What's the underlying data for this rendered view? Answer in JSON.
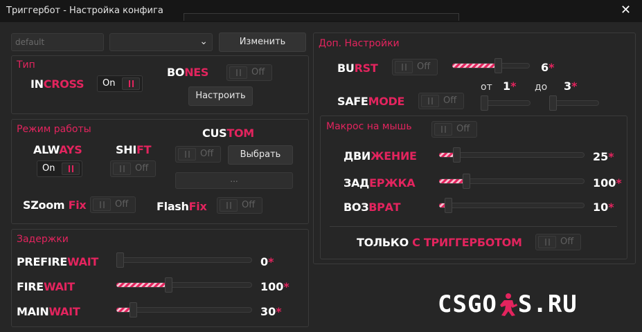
{
  "window": {
    "title": "Триггербот - Настройка конфига",
    "close_glyph": "✕"
  },
  "top": {
    "config_value": "default",
    "dropdown_value": "",
    "change_label": "Изменить"
  },
  "type_panel": {
    "title": "Тип",
    "incross": {
      "w": "IN",
      "p": "CROSS",
      "toggle_text": "On",
      "state": "on"
    },
    "bones": {
      "w": "BO",
      "p": "NES",
      "toggle_text": "Off",
      "state": "off"
    },
    "configure_label": "Настроить"
  },
  "mode_panel": {
    "title": "Режим работы",
    "always": {
      "w": "ALW",
      "p": "AYS",
      "toggle_text": "On",
      "state": "on"
    },
    "shift": {
      "w": "SHI",
      "p": "FT",
      "toggle_text": "Off",
      "state": "off"
    },
    "custom": {
      "w": "CUS",
      "p": "TOM",
      "toggle_text": "Off",
      "state": "off"
    },
    "select_label": "Выбрать",
    "key_value": "...",
    "szoom": {
      "w": "SZoom ",
      "p": "Fix",
      "toggle_text": "Off",
      "state": "off"
    },
    "flash": {
      "w": "Flash",
      "p": "Fix",
      "toggle_text": "Off",
      "state": "off"
    }
  },
  "delays_panel": {
    "title": "Задержки",
    "prefire": {
      "w": "PREFIRE",
      "p": "WAIT",
      "value": "0",
      "star": "*",
      "fraction": 0.0
    },
    "fire": {
      "w": "FIRE",
      "p": "WAIT",
      "value": "100",
      "star": "*",
      "fraction": 0.38
    },
    "main": {
      "w": "MAIN",
      "p": "WAIT",
      "value": "30",
      "star": "*",
      "fraction": 0.1
    }
  },
  "extra_panel": {
    "title": "Доп. Настройки",
    "burst": {
      "w": "BU",
      "p": "RST",
      "toggle_text": "Off",
      "state": "off",
      "value": "6",
      "star": "*",
      "fraction": 0.6
    },
    "from_label": "от",
    "from_value": "1",
    "to_label": "до",
    "to_value": "3",
    "star": "*",
    "safemode": {
      "w": "SAFE",
      "p": "MODE",
      "toggle_text": "Off",
      "state": "off",
      "from_fraction": 0.0,
      "to_fraction": 0.0
    }
  },
  "macro_panel": {
    "title": "Макрос на мышь",
    "toggle_text": "Off",
    "movement": {
      "w": "ДВИ",
      "p": "ЖЕНИЕ",
      "value": "25",
      "star": "*",
      "fraction": 0.1
    },
    "delay": {
      "w": "ЗАД",
      "p": "ЕРЖКА",
      "value": "100",
      "star": "*",
      "fraction": 0.17
    },
    "return": {
      "w": "ВОЗ",
      "p": "ВРАТ",
      "value": "10",
      "star": "*",
      "fraction": 0.04
    },
    "only": {
      "w": "ТОЛЬКО ",
      "p": "С ТРИГГЕРБОТОМ",
      "toggle_text": "Off",
      "state": "off"
    }
  },
  "watermark": {
    "left": "CSGO",
    "right": "S.RU"
  },
  "colors": {
    "accent": "#e3245e",
    "background": "#262626",
    "titlebar": "#161616"
  }
}
